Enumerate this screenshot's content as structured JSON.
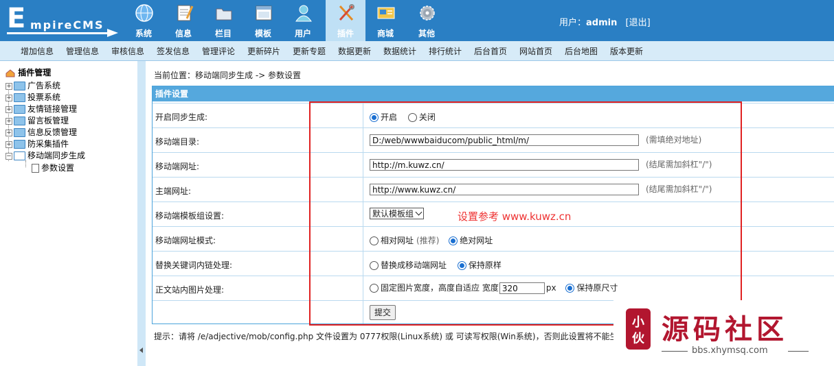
{
  "header": {
    "logo_text_big": "E",
    "logo_text_rest": "mpireCMS",
    "nav": [
      {
        "label": "系统",
        "icon": "globe-icon"
      },
      {
        "label": "信息",
        "icon": "notepad-icon"
      },
      {
        "label": "栏目",
        "icon": "folder-icon"
      },
      {
        "label": "模板",
        "icon": "window-icon"
      },
      {
        "label": "用户",
        "icon": "user-icon"
      },
      {
        "label": "插件",
        "icon": "tools-icon"
      },
      {
        "label": "商城",
        "icon": "shop-card-icon"
      },
      {
        "label": "其他",
        "icon": "gear-icon"
      }
    ],
    "active_nav": "插件",
    "user_prefix": "用户：",
    "username": "admin",
    "logout": "[退出]"
  },
  "subnav": [
    "增加信息",
    "管理信息",
    "审核信息",
    "签发信息",
    "管理评论",
    "更新碎片",
    "更新专题",
    "数据更新",
    "数据统计",
    "排行统计",
    "后台首页",
    "网站首页",
    "后台地图",
    "版本更新"
  ],
  "sidebar": {
    "root": "插件管理",
    "nodes": [
      "广告系统",
      "投票系统",
      "友情链接管理",
      "留言板管理",
      "信息反馈管理",
      "防采集插件",
      "移动端同步生成"
    ],
    "leaf": "参数设置"
  },
  "breadcrumb": {
    "prefix": "当前位置：",
    "path1": "移动端同步生成",
    "sep": " -> ",
    "path2": "参数设置"
  },
  "panel": {
    "title": "插件设置",
    "rows": {
      "sync": {
        "label": "开启同步生成:",
        "opt_on": "开启",
        "opt_off": "关闭",
        "selected": "开启"
      },
      "mobile_dir": {
        "label": "移动端目录:",
        "value": "D:/web/wwwbaiducom/public_html/m/",
        "hint": "(需填绝对地址)"
      },
      "mobile_url": {
        "label": "移动端网址:",
        "value": "http://m.kuwz.cn/",
        "hint": "(结尾需加斜杠\"/\")"
      },
      "main_url": {
        "label": "主端网址:",
        "value": "http://www.kuwz.cn/",
        "hint": "(结尾需加斜杠\"/\")"
      },
      "template": {
        "label": "移动端模板组设置:",
        "selected": "默认模板组"
      },
      "url_mode": {
        "label": "移动端网址模式:",
        "opt_rel": "相对网址",
        "opt_rel_note": "(推荐)",
        "opt_abs": "绝对网址",
        "selected": "绝对网址"
      },
      "keyword": {
        "label": "替换关键词内链处理:",
        "opt_replace": "替换成移动端网址",
        "opt_keep": "保持原样",
        "selected": "保持原样"
      },
      "image": {
        "label": "正文站内图片处理:",
        "opt_fixed": "固定图片宽度，高度自适应 宽度",
        "width_value": "320",
        "unit": "px",
        "opt_keep": "保持原尺寸",
        "selected": "保持原尺寸"
      }
    },
    "submit": "提交"
  },
  "annotation": "设置参考 www.kuwz.cn",
  "tip": "提示：请将 /e/adjective/mob/config.php 文件设置为 0777权限(Linux系统) 或 可读写权限(Win系统)，否则此设置将不能生效。",
  "watermark": {
    "seal": "小伙",
    "name": "源码社区",
    "url": "bbs.xhymsq.com"
  },
  "colors": {
    "header_bg": "#2a7fc4",
    "subnav_bg": "#d7ebf8",
    "panel_title_bg": "#55a8dd",
    "annotation_red": "#e33333",
    "watermark_red": "#b2162f"
  }
}
